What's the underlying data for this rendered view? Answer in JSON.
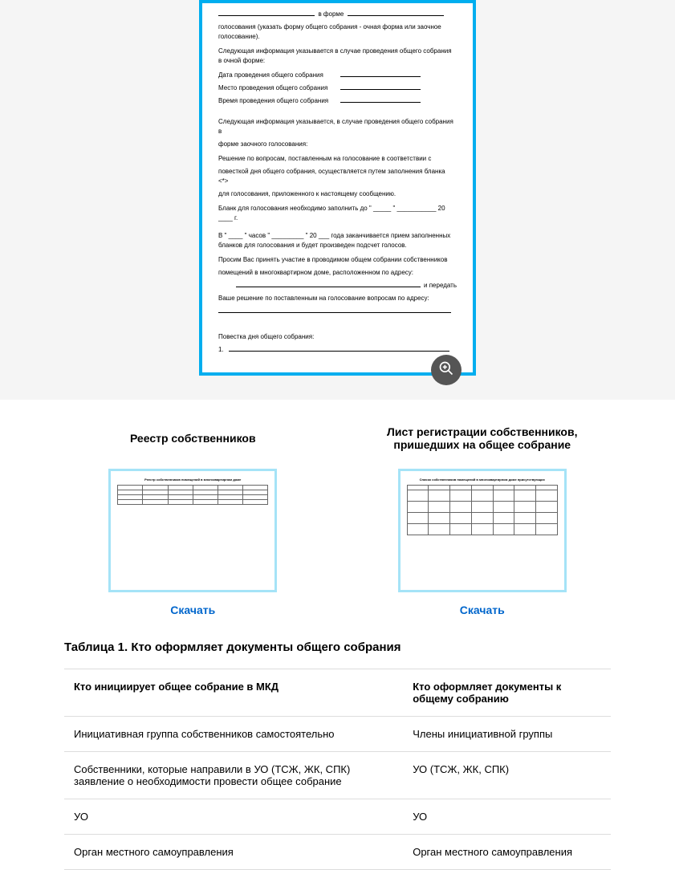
{
  "document": {
    "line_form": "в форме",
    "line_form_note": "голосования (указать форму общего собрания - очная форма или заочное голосование).",
    "info_ocn": "Следующая информация указывается в случае проведения общего собрания в очной форме:",
    "date_row": "Дата проведения общего собрания",
    "place_row": "Место проведения общего собрания",
    "time_row": "Время проведения общего собрания",
    "info_zaoch1": "Следующая информация указывается, в случае проведения общего собрания в",
    "info_zaoch2": "форме заочного голосования:",
    "decision1": "Решение по вопросам, поставленным на голосование в соответствии с",
    "decision2": "повесткой дня общего собрания, осуществляется  путем заполнения бланка <*>",
    "decision3": "для голосования, приложенного к настоящему сообщению.",
    "blank_fill": "Бланк для голосования необходимо заполнить до \"  _____  \" ___________  20  ____ г.",
    "end_line": "В \"  ____  \" часов \"  _________  \" 20  ___  года заканчивается прием заполненных бланков для голосования и будет произведен подсчет голосов.",
    "invite1": "Просим Вас принять участие в проводимом общем собрании собственников",
    "invite2": "помещений в многоквартирном доме, расположенном по адресу:",
    "send": "и передать",
    "decision_addr": "Ваше решение по поставленным на голосование вопросам по адресу:",
    "agenda": "Повестка дня общего собрания:",
    "item1": "1."
  },
  "thumbs": {
    "t1_title": "Реестр собственников",
    "t2_title": "Лист регистрации собственников, пришедших на общее собрание",
    "download": "Скачать"
  },
  "table": {
    "heading": "Таблица 1. Кто оформляет документы общего собрания",
    "h1": "Кто инициирует общее собрание в МКД",
    "h2": "Кто оформляет документы к общему собранию",
    "rows": [
      {
        "c1": "Инициативная группа собственников самостоятельно",
        "c2": "Члены инициативной группы"
      },
      {
        "c1": "Собственники, которые направили в УО (ТСЖ, ЖК, СПК) заявление о необходимости провести общее собрание",
        "c2": "УО (ТСЖ, ЖК, СПК)"
      },
      {
        "c1": "УО",
        "c2": "УО"
      },
      {
        "c1": "Орган местного самоуправления",
        "c2": "Орган местного самоуправления"
      }
    ]
  }
}
